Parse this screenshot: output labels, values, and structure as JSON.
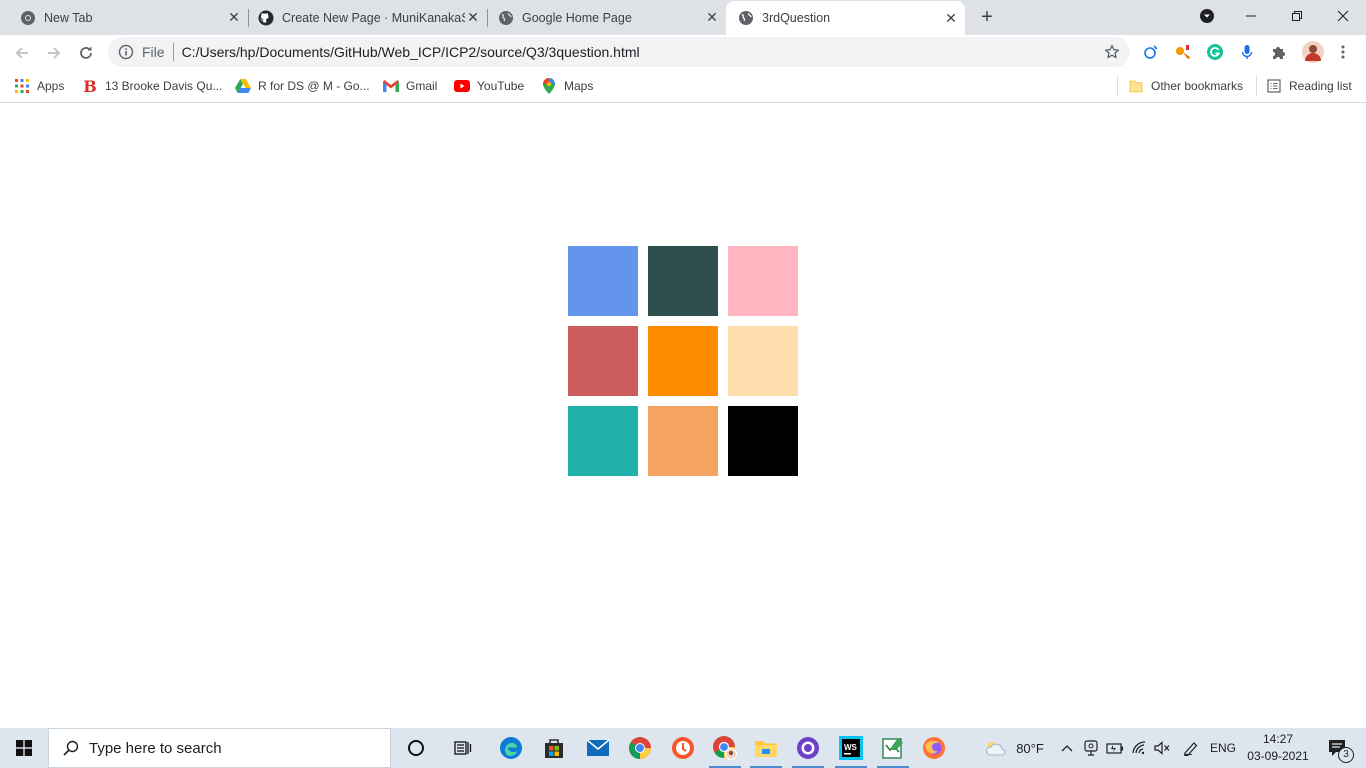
{
  "browser": {
    "tabs": [
      {
        "title": "New Tab",
        "icon": "chrome-icon",
        "active": false
      },
      {
        "title": "Create New Page · MuniKanakaS",
        "icon": "github-icon",
        "active": false
      },
      {
        "title": "Google Home Page",
        "icon": "globe-icon",
        "active": false
      },
      {
        "title": "3rdQuestion",
        "icon": "globe-icon",
        "active": true
      }
    ],
    "new_tab_symbol": "+",
    "omnibox": {
      "scheme_label": "File",
      "url": "C:/Users/hp/Documents/GitHub/Web_ICP/ICP2/source/Q3/3question.html"
    },
    "bookmarks": [
      {
        "label": "Apps",
        "icon": "apps-grid-icon"
      },
      {
        "label": "13 Brooke Davis Qu...",
        "icon": "b-logo-icon"
      },
      {
        "label": "R for DS @ M - Go...",
        "icon": "google-drive-icon"
      },
      {
        "label": "Gmail",
        "icon": "gmail-icon"
      },
      {
        "label": "YouTube",
        "icon": "youtube-icon"
      },
      {
        "label": "Maps",
        "icon": "maps-pin-icon"
      }
    ],
    "other_bookmarks": "Other bookmarks",
    "reading_list": "Reading list"
  },
  "page": {
    "swatches": [
      {
        "color": "#6495ed"
      },
      {
        "color": "#2f4f4f"
      },
      {
        "color": "#ffb6c1"
      },
      {
        "color": "#cd5c5c"
      },
      {
        "color": "#ff8c00"
      },
      {
        "color": "#ffdead"
      },
      {
        "color": "#20b2aa"
      },
      {
        "color": "#f4a460"
      },
      {
        "color": "#000000"
      }
    ]
  },
  "taskbar": {
    "search_placeholder": "Type here to search",
    "weather_temp": "80°F",
    "language": "ENG",
    "time": "14:27",
    "date": "03-09-2021",
    "notification_count": "3"
  }
}
